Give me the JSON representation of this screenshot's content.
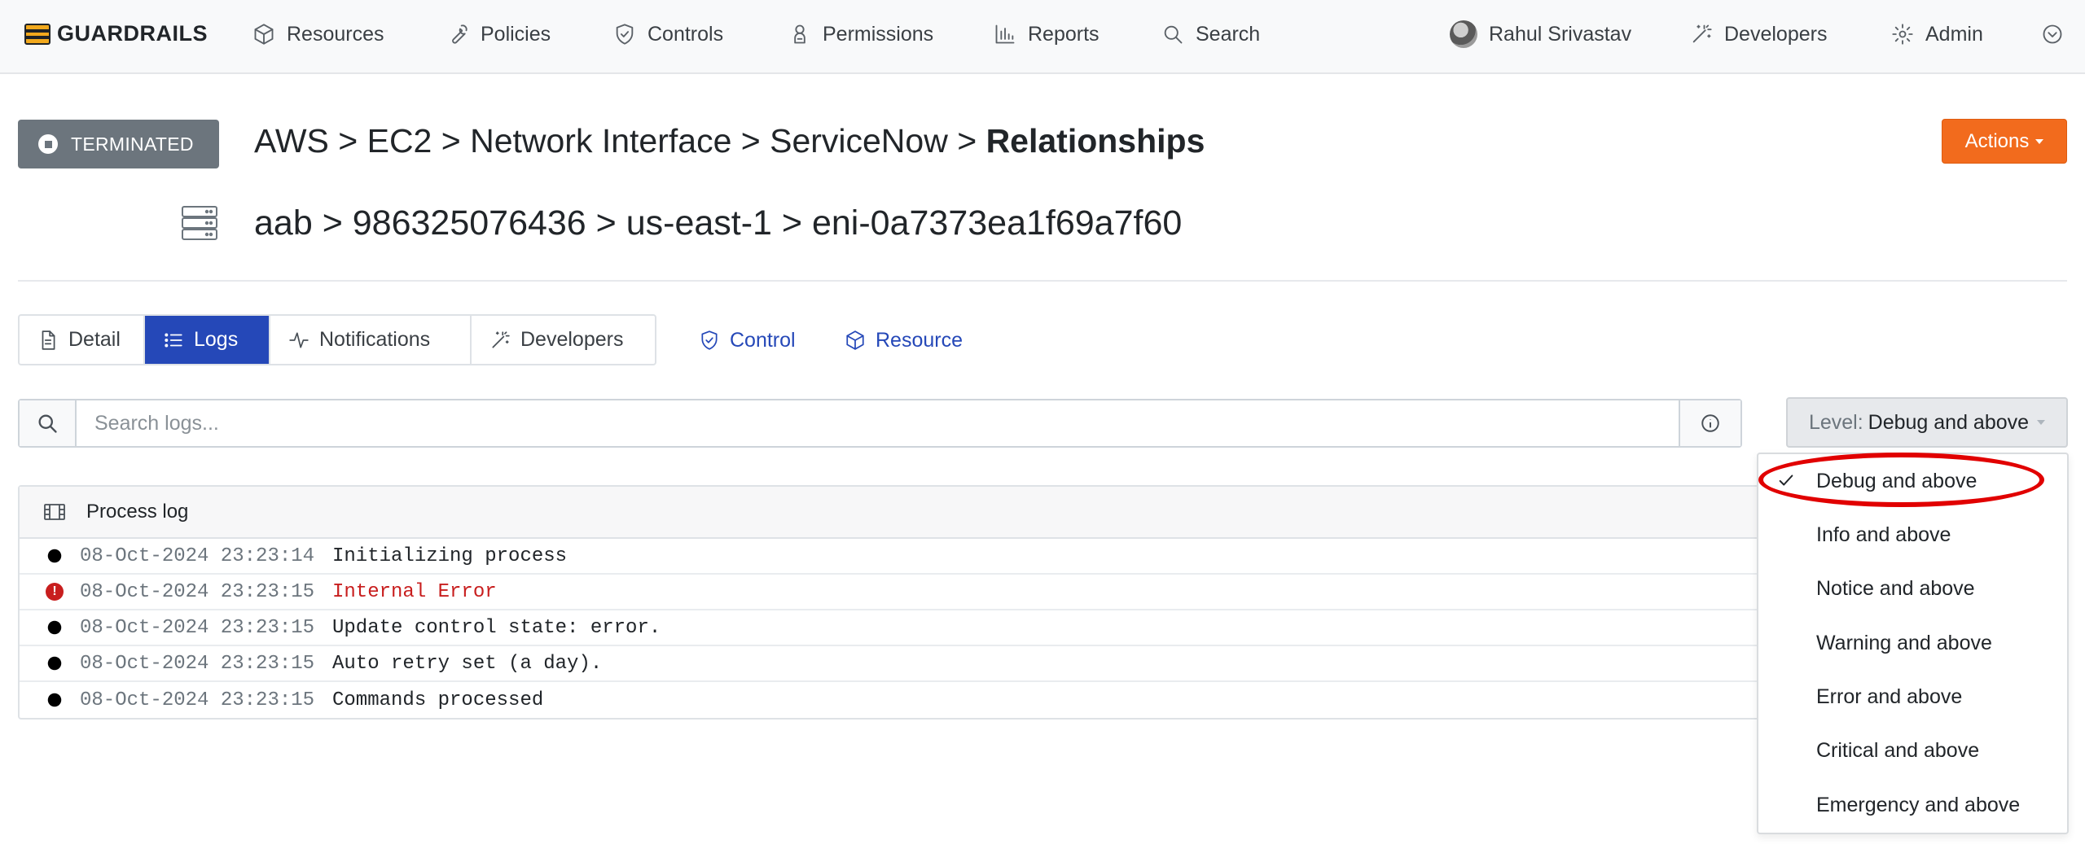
{
  "navbar": {
    "brand": "GUARDRAILS",
    "items": [
      {
        "label": "Resources",
        "icon": "cube-icon"
      },
      {
        "label": "Policies",
        "icon": "wrench-icon"
      },
      {
        "label": "Controls",
        "icon": "shield-check-icon"
      },
      {
        "label": "Permissions",
        "icon": "user-badge-icon"
      },
      {
        "label": "Reports",
        "icon": "bar-chart-icon"
      },
      {
        "label": "Search",
        "icon": "search-icon"
      }
    ],
    "user": "Rahul Srivastav",
    "developers": "Developers",
    "admin": "Admin"
  },
  "header": {
    "status": "TERMINATED",
    "breadcrumb_parts": [
      "AWS > EC2 > Network Interface > ServiceNow > "
    ],
    "breadcrumb_current": "Relationships",
    "resource_path": "aab > 986325076436 > us-east-1 > eni-0a7373ea1f69a7f60",
    "actions_label": "Actions"
  },
  "tabs": [
    {
      "label": "Detail",
      "active": false
    },
    {
      "label": "Logs",
      "active": true
    },
    {
      "label": "Notifications",
      "active": false
    },
    {
      "label": "Developers",
      "active": false
    }
  ],
  "links": {
    "control": "Control",
    "resource": "Resource"
  },
  "search": {
    "placeholder": "Search logs...",
    "value": ""
  },
  "level": {
    "label": "Level:",
    "value": "Debug and above",
    "options": [
      {
        "label": "Debug and above",
        "selected": true
      },
      {
        "label": "Info and above",
        "selected": false
      },
      {
        "label": "Notice and above",
        "selected": false
      },
      {
        "label": "Warning and above",
        "selected": false
      },
      {
        "label": "Error and above",
        "selected": false
      },
      {
        "label": "Critical and above",
        "selected": false
      },
      {
        "label": "Emergency and above",
        "selected": false
      }
    ]
  },
  "log": {
    "title": "Process log",
    "rows": [
      {
        "level": "info",
        "time": "08-Oct-2024 23:23:14",
        "message": "Initializing process"
      },
      {
        "level": "error",
        "time": "08-Oct-2024 23:23:15",
        "message": "Internal Error"
      },
      {
        "level": "info",
        "time": "08-Oct-2024 23:23:15",
        "message": "Update control state: error."
      },
      {
        "level": "info",
        "time": "08-Oct-2024 23:23:15",
        "message": "Auto retry set (a day)."
      },
      {
        "level": "info",
        "time": "08-Oct-2024 23:23:15",
        "message": "Commands processed"
      }
    ]
  },
  "colors": {
    "accent": "#2548b8",
    "actions": "#f26b1d",
    "status_badge": "#6c757d",
    "error": "#c81e1e",
    "highlight": "#e10000"
  }
}
